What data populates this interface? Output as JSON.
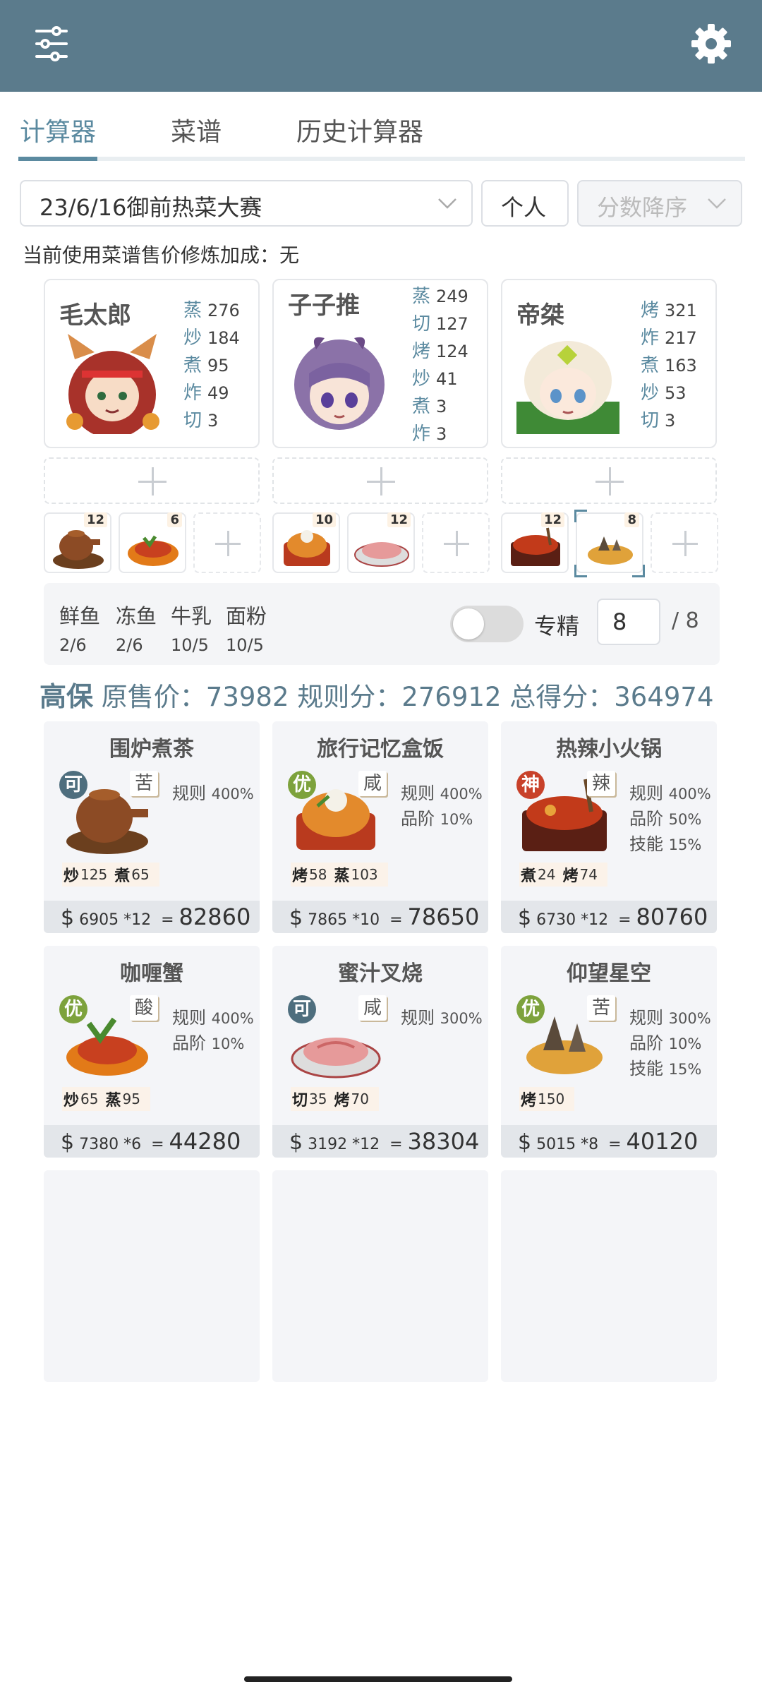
{
  "tabs": [
    {
      "label": "计算器",
      "active": true
    },
    {
      "label": "菜谱",
      "active": false
    },
    {
      "label": "历史计算器",
      "active": false
    }
  ],
  "contest_select": {
    "value": "23/6/16御前热菜大赛"
  },
  "mode_button": {
    "label": "个人"
  },
  "sort_select": {
    "value": "分数降序"
  },
  "info_line": "当前使用菜谱售价修炼加成：无",
  "chefs": [
    {
      "name": "毛太郎",
      "skills": [
        {
          "k": "蒸",
          "v": "276"
        },
        {
          "k": "炒",
          "v": "184"
        },
        {
          "k": "煮",
          "v": "95"
        },
        {
          "k": "炸",
          "v": "49"
        },
        {
          "k": "切",
          "v": "3"
        }
      ],
      "dishes": [
        {
          "qty": "12"
        },
        {
          "qty": "6"
        }
      ]
    },
    {
      "name": "子子推",
      "skills": [
        {
          "k": "蒸",
          "v": "249"
        },
        {
          "k": "切",
          "v": "127"
        },
        {
          "k": "烤",
          "v": "124"
        },
        {
          "k": "炒",
          "v": "41"
        },
        {
          "k": "煮",
          "v": "3"
        },
        {
          "k": "炸",
          "v": "3"
        }
      ],
      "dishes": [
        {
          "qty": "10"
        },
        {
          "qty": "12"
        }
      ]
    },
    {
      "name": "帝桀",
      "skills": [
        {
          "k": "烤",
          "v": "321"
        },
        {
          "k": "炸",
          "v": "217"
        },
        {
          "k": "煮",
          "v": "163"
        },
        {
          "k": "炒",
          "v": "53"
        },
        {
          "k": "切",
          "v": "3"
        }
      ],
      "dishes": [
        {
          "qty": "12"
        },
        {
          "qty": "8"
        }
      ]
    }
  ],
  "ingredients": [
    {
      "name": "鲜鱼",
      "count": "2/6"
    },
    {
      "name": "冻鱼",
      "count": "2/6"
    },
    {
      "name": "牛乳",
      "count": "10/5"
    },
    {
      "name": "面粉",
      "count": "10/5"
    }
  ],
  "specialize": {
    "label": "专精",
    "value": "8",
    "total": "/ 8",
    "toggle_on": false
  },
  "summary": {
    "guarantee": "高保",
    "text": "原售价：73982 规则分：276912 总得分：364974"
  },
  "recipes": [
    {
      "title": "围炉煮茶",
      "rank": "可",
      "rank_color": "#4e6e7e",
      "taste": "苦",
      "bonus": [
        {
          "label": "规则",
          "pct": "400%"
        }
      ],
      "reqs": [
        {
          "s": "炒",
          "n": "125"
        },
        {
          "s": "煮",
          "n": "65"
        }
      ],
      "price": "6905",
      "mult": "*12",
      "total": "82860"
    },
    {
      "title": "旅行记忆盒饭",
      "rank": "优",
      "rank_color": "#7da23c",
      "taste": "咸",
      "bonus": [
        {
          "label": "规则",
          "pct": "400%"
        },
        {
          "label": "品阶",
          "pct": "10%"
        }
      ],
      "reqs": [
        {
          "s": "烤",
          "n": "58"
        },
        {
          "s": "蒸",
          "n": "103"
        }
      ],
      "price": "7865",
      "mult": "*10",
      "total": "78650"
    },
    {
      "title": "热辣小火锅",
      "rank": "神",
      "rank_color": "#c8412a",
      "taste": "辣",
      "bonus": [
        {
          "label": "规则",
          "pct": "400%"
        },
        {
          "label": "品阶",
          "pct": "50%"
        },
        {
          "label": "技能",
          "pct": "15%"
        }
      ],
      "reqs": [
        {
          "s": "煮",
          "n": "24"
        },
        {
          "s": "烤",
          "n": "74"
        }
      ],
      "price": "6730",
      "mult": "*12",
      "total": "80760"
    },
    {
      "title": "咖喱蟹",
      "rank": "优",
      "rank_color": "#7da23c",
      "taste": "酸",
      "bonus": [
        {
          "label": "规则",
          "pct": "400%"
        },
        {
          "label": "品阶",
          "pct": "10%"
        }
      ],
      "reqs": [
        {
          "s": "炒",
          "n": "65"
        },
        {
          "s": "蒸",
          "n": "95"
        }
      ],
      "price": "7380",
      "mult": "*6",
      "total": "44280"
    },
    {
      "title": "蜜汁叉烧",
      "rank": "可",
      "rank_color": "#4e6e7e",
      "taste": "咸",
      "bonus": [
        {
          "label": "规则",
          "pct": "300%"
        }
      ],
      "reqs": [
        {
          "s": "切",
          "n": "35"
        },
        {
          "s": "烤",
          "n": "70"
        }
      ],
      "price": "3192",
      "mult": "*12",
      "total": "38304"
    },
    {
      "title": "仰望星空",
      "rank": "优",
      "rank_color": "#7da23c",
      "taste": "苦",
      "bonus": [
        {
          "label": "规则",
          "pct": "300%"
        },
        {
          "label": "品阶",
          "pct": "10%"
        },
        {
          "label": "技能",
          "pct": "15%"
        }
      ],
      "reqs": [
        {
          "s": "烤",
          "n": "150"
        }
      ],
      "price": "5015",
      "mult": "*8",
      "total": "40120"
    }
  ],
  "colors": {
    "header": "#5b7b8c",
    "accent": "#5b8aa0"
  }
}
